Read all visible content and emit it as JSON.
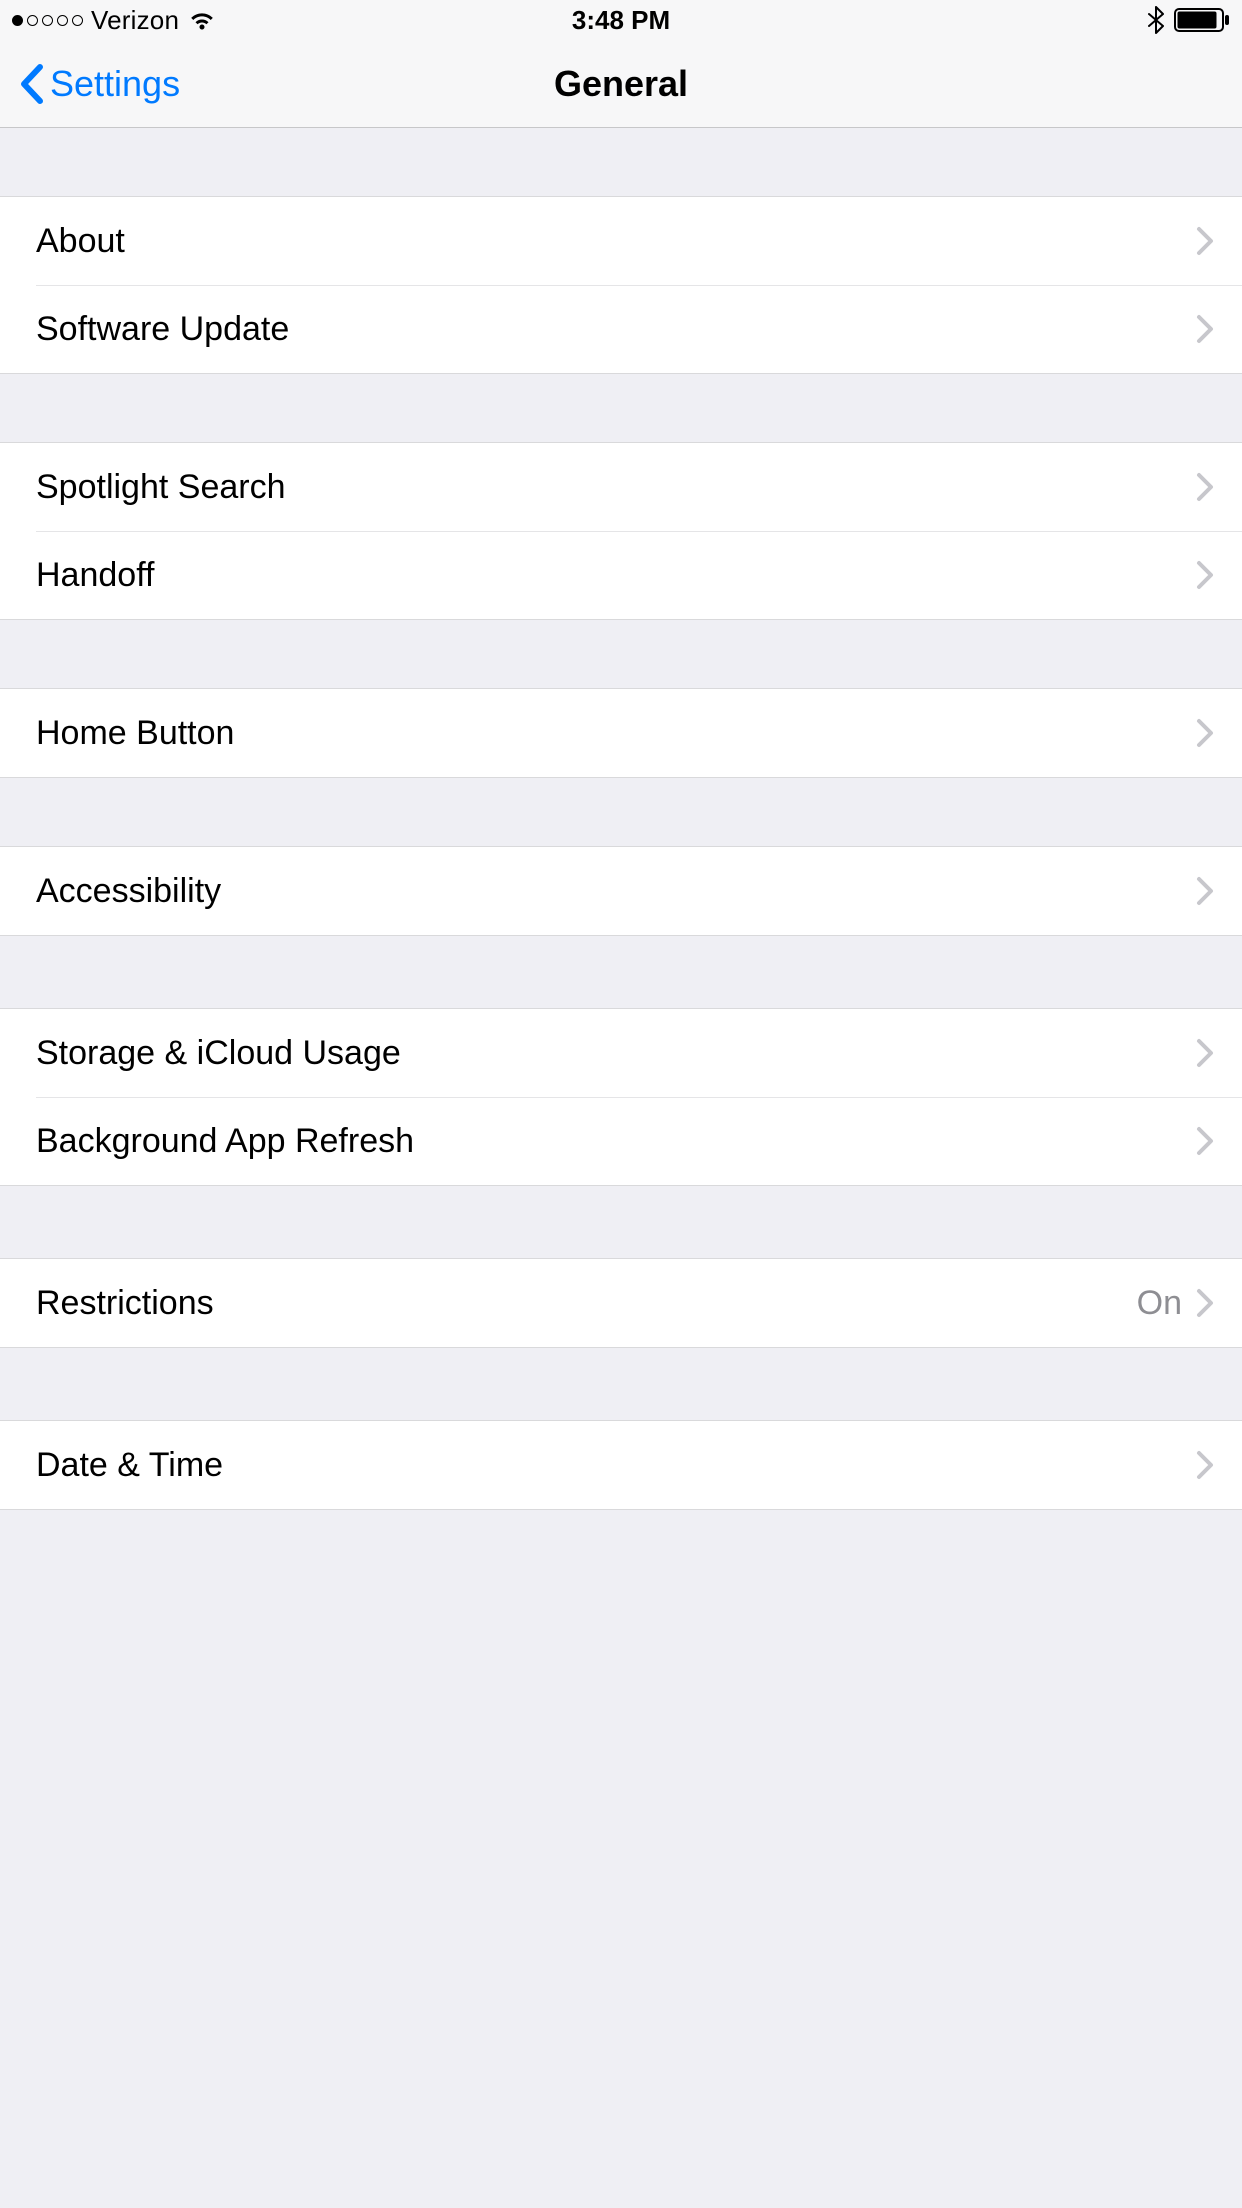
{
  "statusBar": {
    "carrier": "Verizon",
    "time": "3:48 PM"
  },
  "nav": {
    "back": "Settings",
    "title": "General"
  },
  "groups": [
    {
      "rows": [
        {
          "label": "About"
        },
        {
          "label": "Software Update"
        }
      ]
    },
    {
      "rows": [
        {
          "label": "Spotlight Search"
        },
        {
          "label": "Handoff"
        }
      ]
    },
    {
      "rows": [
        {
          "label": "Home Button"
        }
      ]
    },
    {
      "rows": [
        {
          "label": "Accessibility"
        }
      ]
    },
    {
      "rows": [
        {
          "label": "Storage & iCloud Usage"
        },
        {
          "label": "Background App Refresh"
        }
      ]
    },
    {
      "rows": [
        {
          "label": "Restrictions",
          "value": "On"
        }
      ]
    },
    {
      "rows": [
        {
          "label": "Date & Time"
        }
      ]
    }
  ]
}
